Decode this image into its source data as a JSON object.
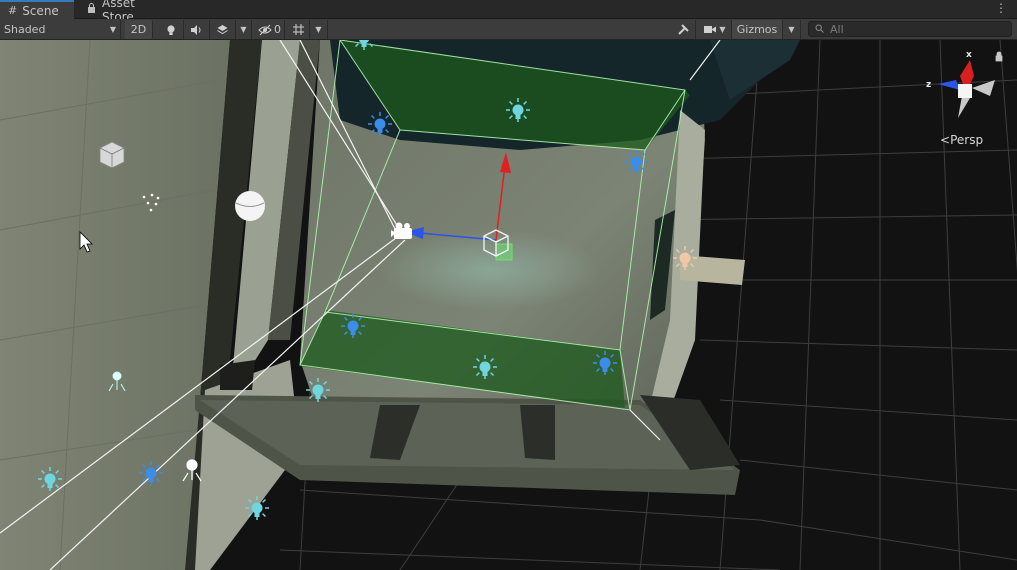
{
  "tabs": [
    {
      "label": "Scene",
      "icon": "hash-icon",
      "active": true
    },
    {
      "label": "Asset Store",
      "icon": "store-bag-icon",
      "active": false
    }
  ],
  "toolbar": {
    "shading_mode": "Shaded",
    "btn_2d": "2D",
    "hidden_count": "0",
    "gizmos_label": "Gizmos",
    "search_placeholder": "All"
  },
  "orientation_gizmo": {
    "axis_x": "x",
    "axis_z": "z",
    "projection_label": "Persp"
  },
  "colors": {
    "accent_tab": "#3a79bb",
    "selection_box": "#9ef59e",
    "axis_y": "#e02020",
    "axis_z": "#2a55e8",
    "light_icon": "#6fd6e0"
  }
}
